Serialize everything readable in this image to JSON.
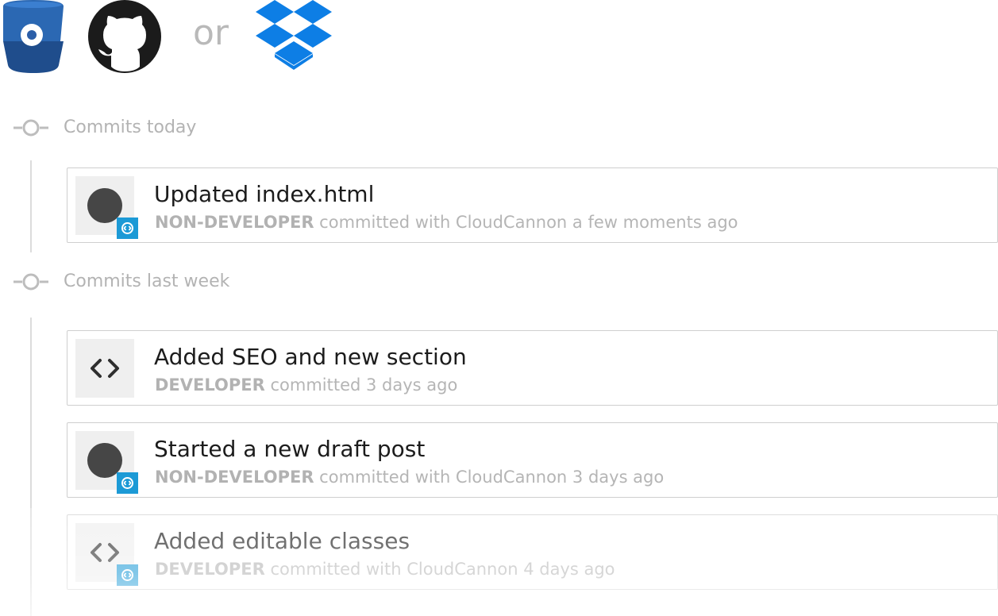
{
  "providers": {
    "bitbucket_icon": "bitbucket-icon",
    "github_icon": "github-icon",
    "or_text": "or",
    "dropbox_icon": "dropbox-icon"
  },
  "colors": {
    "bitbucket_blue": "#1f4d8c",
    "dropbox_blue": "#0d7ee5",
    "cloudcannon_blue": "#1c9ad6",
    "avatar_dark": "#464646"
  },
  "sections": {
    "today": {
      "title": "Commits today"
    },
    "last_week": {
      "title": "Commits last week"
    }
  },
  "commits": [
    {
      "title": "Updated index.html",
      "role": "NON-DEVELOPER",
      "detail": "committed with CloudCannon a few moments ago",
      "avatar": "user-avatar",
      "badge": "cloudcannon-badge-icon"
    },
    {
      "title": "Added SEO and new section",
      "role": "DEVELOPER",
      "detail": "committed 3 days ago",
      "avatar": "code-icon"
    },
    {
      "title": "Started a new draft post",
      "role": "NON-DEVELOPER",
      "detail": "committed with CloudCannon 3 days ago",
      "avatar": "user-avatar",
      "badge": "cloudcannon-badge-icon"
    },
    {
      "title": "Added editable classes",
      "role": "DEVELOPER",
      "detail": "committed with CloudCannon 4 days ago",
      "avatar": "code-icon",
      "badge": "cloudcannon-badge-icon"
    }
  ]
}
